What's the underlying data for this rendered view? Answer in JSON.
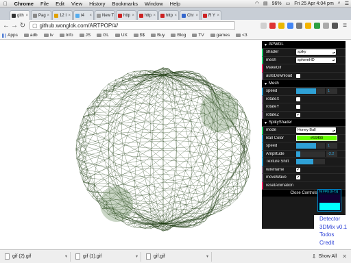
{
  "menubar": {
    "app": "Chrome",
    "items": [
      "File",
      "Edit",
      "View",
      "History",
      "Bookmarks",
      "Window",
      "Help"
    ],
    "battery": "96%",
    "datetime": "Fri 25 Apr  4:04 pm"
  },
  "tabs": [
    {
      "label": "gith",
      "color": "#333333",
      "active": true
    },
    {
      "label": "Pag",
      "color": "#888888",
      "active": false
    },
    {
      "label": "12 I",
      "color": "#e0a000",
      "active": false
    },
    {
      "label": "t4",
      "color": "#55acee",
      "active": false
    },
    {
      "label": "New T",
      "color": "#999999",
      "active": false
    },
    {
      "label": "http",
      "color": "#cc2222",
      "active": false
    },
    {
      "label": "http",
      "color": "#cc2222",
      "active": false
    },
    {
      "label": "http",
      "color": "#cc2222",
      "active": false
    },
    {
      "label": "Chr",
      "color": "#3366cc",
      "active": false
    },
    {
      "label": "R Y",
      "color": "#cc2222",
      "active": false
    }
  ],
  "toolbar": {
    "back": "←",
    "forward": "→",
    "reload": "↻",
    "url": "github.wonglok.com/ARTPOP/#/",
    "extension_colors": [
      "#d0d0d0",
      "#d33",
      "#e9b700",
      "#4285f4",
      "#7a7a7a",
      "#f4b400",
      "#2ea043",
      "#aaaaaa",
      "#555555"
    ]
  },
  "bookmarks": [
    {
      "label": "Apps",
      "type": "apps"
    },
    {
      "label": "adb",
      "type": "folder"
    },
    {
      "label": "tv",
      "type": "folder"
    },
    {
      "label": "Info",
      "type": "folder"
    },
    {
      "label": "JS",
      "type": "folder"
    },
    {
      "label": "GL",
      "type": "folder"
    },
    {
      "label": "UX",
      "type": "folder"
    },
    {
      "label": "$$",
      "type": "folder"
    },
    {
      "label": "Buy",
      "type": "folder"
    },
    {
      "label": "Blog",
      "type": "folder"
    },
    {
      "label": "TV",
      "type": "folder"
    },
    {
      "label": "games",
      "type": "folder"
    },
    {
      "label": "<3",
      "type": "folder"
    }
  ],
  "gui": {
    "apwgl": {
      "title": "APWGL",
      "shader_label": "shader",
      "shader_value": "spiky",
      "mesh_label": "mesh",
      "mesh_value": "sphereHD",
      "makegif_label": "MakeGif",
      "autodownload_label": "autoDownload",
      "autodownload_checked": false
    },
    "mesh": {
      "title": "Mesh",
      "speed_label": "speed",
      "speed_value": "1",
      "speed_fill": 0.7,
      "rotatex_label": "rotateX",
      "rotatex_checked": false,
      "rotatey_label": "rotateY",
      "rotatey_checked": false,
      "rotatez_label": "rotateZ",
      "rotatez_checked": true
    },
    "spiky": {
      "title": "SpikyShader",
      "mode_label": "mode",
      "mode_value": "Honey Ball",
      "color_label": "Ball Color",
      "color_value": "#66ff00",
      "speed_label": "speed",
      "speed_value": "1",
      "speed_fill": 0.7,
      "amplitude_label": "Amplitude",
      "amplitude_value": "-2.2",
      "amplitude_fill": 0.15,
      "texture_label": "Texture Shift",
      "texture_fill": 0.6,
      "wireframe_label": "wireframe",
      "wireframe_checked": true,
      "movewave_label": "moveWave",
      "movewave_checked": true,
      "reset_label": "resetAnimation"
    },
    "close_label": "Close Controls"
  },
  "stats": {
    "text": "76 FPS (0-72)"
  },
  "menu_links": [
    "Detector",
    "3DMix v0.1",
    "Todos",
    "Credit"
  ],
  "downloads": [
    {
      "name": "gif (2).gif"
    },
    {
      "name": "gif (1).gif"
    },
    {
      "name": "gif.gif"
    }
  ],
  "show_all": "Show All",
  "close_downloads": "✕"
}
